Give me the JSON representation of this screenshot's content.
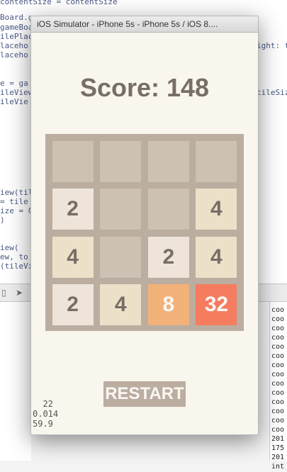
{
  "editor": {
    "lines": [
      "contentSize = contentSize",
      "Board.ga",
      "gameBoa",
      "ilePlace",
      "laceho",
      "laceho",
      "ight: t",
      "e = ga",
      "ileView",
      "ileVie",
      "tileSiz",
      "iew(til",
      " = tile",
      "ize = C",
      ")",
      "iew(",
      "ew, to",
      "(tileVi"
    ]
  },
  "console": {
    "lines": [
      "coo",
      "coo",
      "coo",
      "coo",
      "coo",
      "coo",
      "coo",
      "coo",
      "coo",
      "coo",
      "coo",
      "coo",
      "coo",
      "coo",
      "201",
      "175",
      "201",
      "int"
    ]
  },
  "simulator": {
    "title": "iOS Simulator - iPhone 5s - iPhone 5s / iOS 8....",
    "score": "Score: 148",
    "board": [
      [
        "",
        "",
        "",
        ""
      ],
      [
        "2",
        "",
        "",
        "4"
      ],
      [
        "4",
        "",
        "2",
        "4"
      ],
      [
        "2",
        "4",
        "8",
        "32"
      ]
    ],
    "restart_label": "RESTART",
    "perf_stats": {
      "line1": "  22",
      "line2": "0.014",
      "line3": "59.9"
    }
  },
  "colors": {
    "background": "#f9f6ee",
    "board": "#bbada0",
    "empty": "#cdc1b4",
    "tile_2": "#eee4da",
    "tile_4": "#ede0c8",
    "tile_8": "#f2b179",
    "tile_32": "#f67c5f",
    "text": "#776e65"
  }
}
